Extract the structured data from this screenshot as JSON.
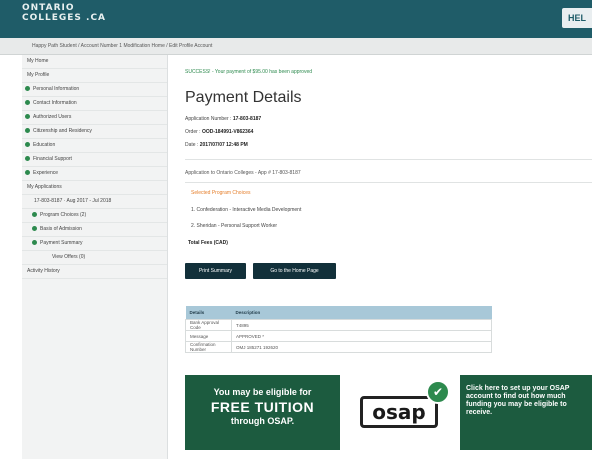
{
  "header": {
    "logo_line1": "ONTARIO",
    "logo_line2": "COLLEGES .CA",
    "help_label": "HEL"
  },
  "breadcrumb": "Happy Path Student / Account Number 1 Modification Home / Edit Profile Account",
  "sidebar": {
    "items": [
      {
        "label": "My Home",
        "style": "plain"
      },
      {
        "label": "My Profile",
        "style": "plain"
      },
      {
        "label": "Personal Information",
        "style": "check"
      },
      {
        "label": "Contact Information",
        "style": "check"
      },
      {
        "label": "Authorized Users",
        "style": "check"
      },
      {
        "label": "Citizenship and Residency",
        "style": "check"
      },
      {
        "label": "Education",
        "style": "check"
      },
      {
        "label": "Financial Support",
        "style": "check"
      },
      {
        "label": "Experience",
        "style": "check"
      },
      {
        "label": "My Applications",
        "style": "plain"
      },
      {
        "label": "17-803-8187 · Aug 2017 - Jul 2018",
        "style": "sub"
      },
      {
        "label": "Program Choices (2)",
        "style": "sub-check"
      },
      {
        "label": "Basis of Admission",
        "style": "sub-check"
      },
      {
        "label": "Payment Summary",
        "style": "sub-check"
      },
      {
        "label": "View Offers (0)",
        "style": "sub3"
      },
      {
        "label": "Activity History",
        "style": "plain"
      }
    ]
  },
  "main": {
    "crumb": "SUCCESS! - Your payment of $95.00 has been approved",
    "title": "Payment Details",
    "meta": [
      {
        "label": "Application Number :",
        "value": "17-803-8187"
      },
      {
        "label": "Order :",
        "value": "OOD-184991-V862364"
      },
      {
        "label": "Date :",
        "value": "2017/07/07 12:48 PM"
      }
    ],
    "app_line": "Application to Ontario Colleges - App # 17-803-8187",
    "programs_heading": "Selected Program Choices",
    "programs": [
      "1. Confederation - Interactive Media Development",
      "2. Sheridan - Personal Support Worker"
    ],
    "total_label": "Total Fees (CAD)",
    "print_button": "Print Summary",
    "home_button": "Go to the Home Page",
    "table": {
      "headers": [
        "Details",
        "Description"
      ],
      "rows": [
        [
          "Bank Approval Code",
          "T4895"
        ],
        [
          "Message",
          "APPROVED *"
        ],
        [
          "Confirmation Number",
          "OMJ 185271 192620"
        ]
      ]
    }
  },
  "banner": {
    "line1": "You may be eligible for",
    "line2": "FREE TUITION",
    "line3": "through OSAP.",
    "logo": "osap",
    "cta": "Click here to set up your OSAP account to find out how much funding you may be eligible to receive."
  }
}
